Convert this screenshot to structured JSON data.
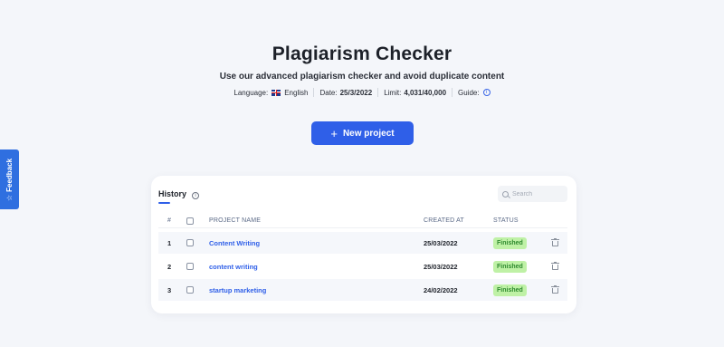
{
  "page": {
    "title": "Plagiarism Checker",
    "subtitle": "Use our advanced plagiarism checker and avoid duplicate content"
  },
  "meta": {
    "language_label": "Language:",
    "language_value": "English",
    "language_flag": "uk-flag-icon",
    "date_label": "Date:",
    "date_value": "25/3/2022",
    "limit_label": "Limit:",
    "limit_value": "4,031/40,000",
    "guide_label": "Guide:"
  },
  "actions": {
    "new_project_label": "New project"
  },
  "feedback": {
    "label": "Feedback"
  },
  "history": {
    "tab_label": "History",
    "search_placeholder": "Search",
    "columns": {
      "num": "#",
      "project_name": "PROJECT NAME",
      "created_at": "CREATED AT",
      "status": "STATUS"
    },
    "rows": [
      {
        "num": "1",
        "name": "Content Writing",
        "created": "25/03/2022",
        "status": "Finished"
      },
      {
        "num": "2",
        "name": "content writing",
        "created": "25/03/2022",
        "status": "Finished"
      },
      {
        "num": "3",
        "name": "startup marketing",
        "created": "24/02/2022",
        "status": "Finished"
      }
    ]
  },
  "colors": {
    "accent": "#2f5fe8",
    "status_finished_bg": "#bff1a6",
    "status_finished_text": "#2e8a2e",
    "feedback_bg": "#2f6fe0"
  }
}
